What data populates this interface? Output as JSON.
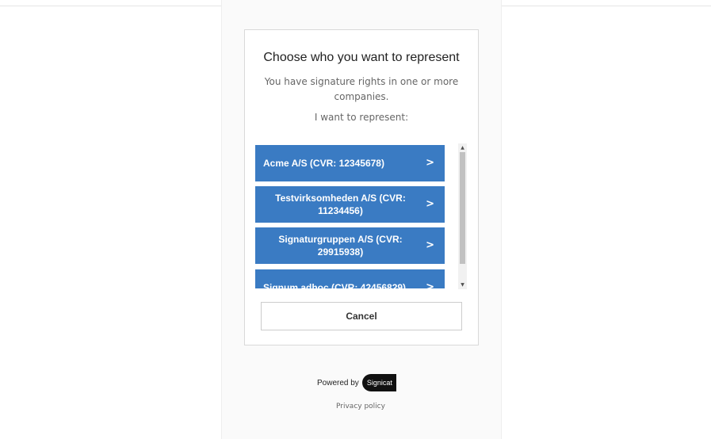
{
  "dialog": {
    "title": "Choose who you want to represent",
    "subtitle": "You have signature rights in one or more companies.",
    "prompt": "I want to represent:"
  },
  "companies": [
    {
      "label": "Acme A/S (CVR: 12345678)"
    },
    {
      "label": "Testvirksomheden A/S (CVR: 11234456)"
    },
    {
      "label": "Signaturgruppen A/S (CVR: 29915938)"
    },
    {
      "label": "Signum adhoc (CVR: 42456829)"
    }
  ],
  "chevron_icon": ">",
  "scrollbar": {
    "up": "▲",
    "down": "▼"
  },
  "cancel_label": "Cancel",
  "footer": {
    "powered_by": "Powered by",
    "logo_text": "Signicat",
    "privacy": "Privacy policy"
  },
  "colors": {
    "company_button": "#3a7bc3",
    "logo_background": "#111111"
  }
}
